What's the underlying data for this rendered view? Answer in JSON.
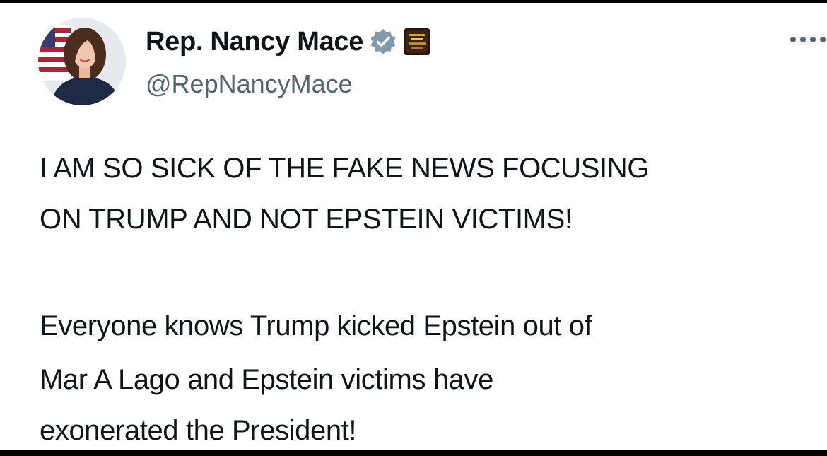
{
  "tweet": {
    "author": {
      "display_name": "Rep. Nancy Mace",
      "handle": "@RepNancyMace",
      "verified_icon": "verified-badge-icon",
      "affiliation_icon": "affiliation-badge-icon"
    },
    "more_icon": "more-options-icon",
    "body": {
      "line1": "I AM SO SICK OF THE FAKE NEWS FOCUSING",
      "line2": "ON TRUMP AND NOT EPSTEIN VICTIMS!",
      "line3": "Everyone knows Trump kicked Epstein out of",
      "line4": "Mar A Lago and Epstein victims have",
      "line5": "exonerated the President!"
    }
  },
  "colors": {
    "text": "#0f1419",
    "secondary_text": "#536471",
    "badge": "#829aab",
    "frame": "#000000"
  }
}
